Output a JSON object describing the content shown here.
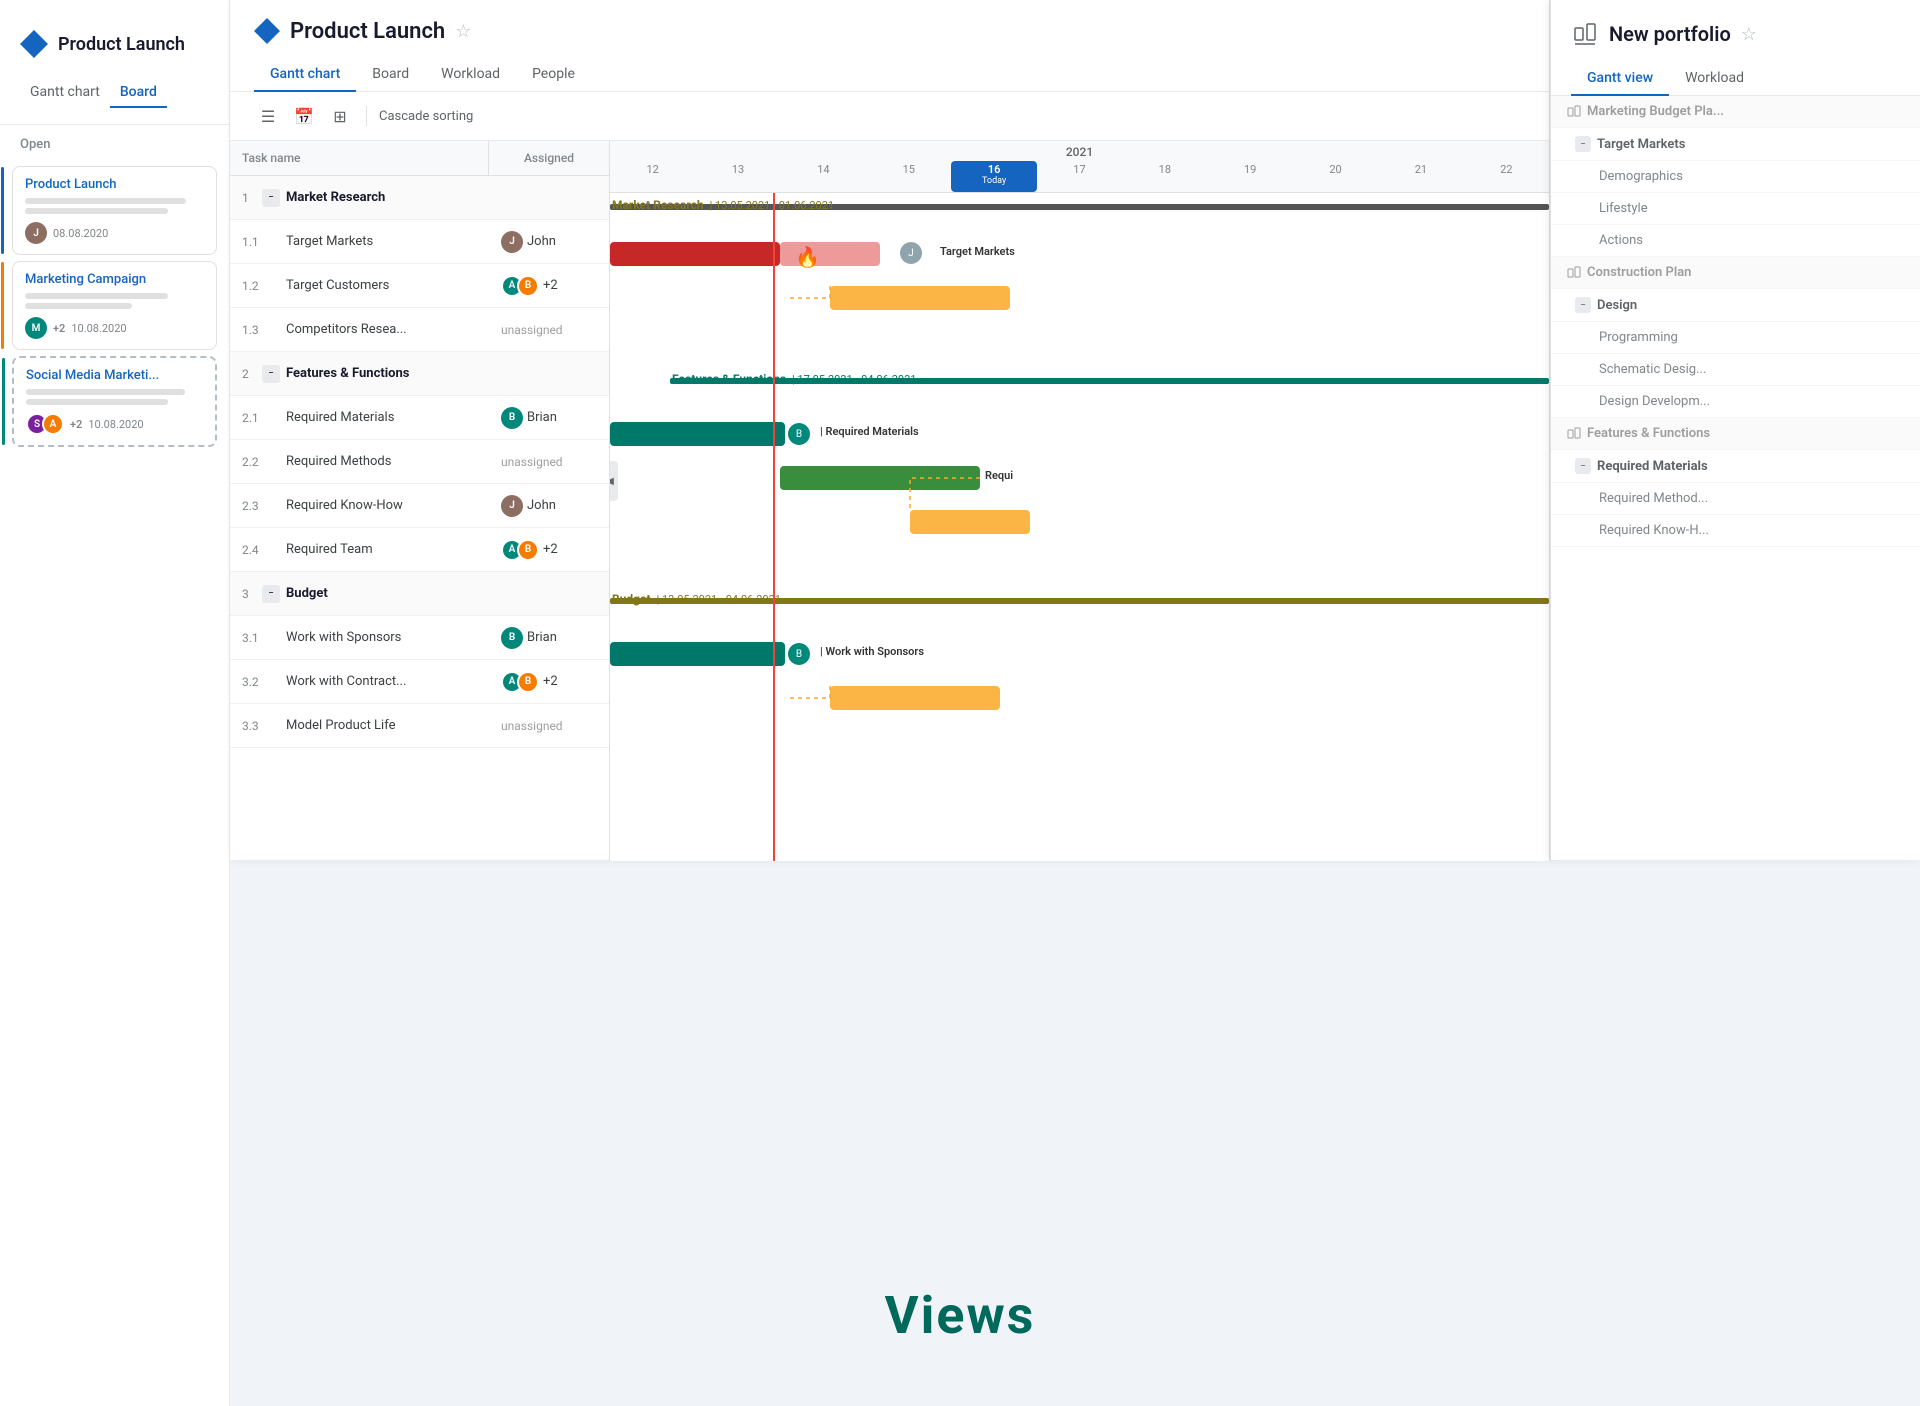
{
  "sidebar": {
    "title": "Product Launch",
    "nav": [
      {
        "label": "Gantt chart",
        "active": false
      },
      {
        "label": "Board",
        "active": true
      }
    ],
    "section": "Open",
    "cards": [
      {
        "id": "card-1",
        "title": "Product Launch",
        "bar_lengths": [
          "long",
          "medium"
        ],
        "avatar_color": "brown",
        "date": "08.08.2020",
        "accent": "blue"
      },
      {
        "id": "card-2",
        "title": "Marketing Campaign",
        "bar_lengths": [
          "medium",
          "short"
        ],
        "avatar_color": "teal",
        "plus": "+2",
        "date": "10.08.2020",
        "accent": "orange"
      },
      {
        "id": "card-3",
        "title": "Social Media Marketi...",
        "bar_lengths": [
          "long",
          "medium"
        ],
        "avatar_color": "purple",
        "plus": "+2",
        "date": "10.08.2020",
        "accent": "teal",
        "dashed": true
      }
    ]
  },
  "main": {
    "title": "Product Launch",
    "tabs": [
      {
        "label": "Gantt chart",
        "active": true
      },
      {
        "label": "Board",
        "active": false
      },
      {
        "label": "Workload",
        "active": false
      },
      {
        "label": "People",
        "active": false
      }
    ],
    "toolbar": {
      "cascade_sorting": "Cascade sorting"
    },
    "gantt": {
      "year": "2021",
      "today_label": "Today",
      "days": [
        "12",
        "13",
        "14",
        "15",
        "16",
        "17",
        "18",
        "19",
        "20",
        "21",
        "22"
      ],
      "today_index": 4,
      "columns": {
        "task_name": "Task name",
        "assigned": "Assigned"
      },
      "groups": [
        {
          "num": "1",
          "name": "Market Research",
          "label": "Market Research",
          "date_range": "13.05.2021 - 01.06.2021",
          "color": "olive",
          "children": [
            {
              "num": "1.1",
              "name": "Target Markets",
              "assigned": "John",
              "bar_color": "red",
              "bar_light": "red-light",
              "has_fire": true,
              "label": "Target Markets"
            },
            {
              "num": "1.2",
              "name": "Target Customers",
              "assigned": "multi",
              "plus": "+2",
              "bar_color": "gold"
            },
            {
              "num": "1.3",
              "name": "Competitors Resea...",
              "assigned": "unassigned"
            }
          ]
        },
        {
          "num": "2",
          "name": "Features & Functions",
          "label": "Features & Functions",
          "date_range": "17.05.2021 - 04.06.2021",
          "color": "teal",
          "children": [
            {
              "num": "2.1",
              "name": "Required Materials",
              "assigned": "Brian",
              "bar_color": "teal",
              "label": "Required Materials"
            },
            {
              "num": "2.2",
              "name": "Required Methods",
              "assigned": "unassigned",
              "bar_color": "green",
              "label": "Requi"
            },
            {
              "num": "2.3",
              "name": "Required Know-How",
              "assigned": "John",
              "bar_color": "gold"
            },
            {
              "num": "2.4",
              "name": "Required Team",
              "assigned": "multi",
              "plus": "+2"
            }
          ]
        },
        {
          "num": "3",
          "name": "Budget",
          "label": "Budget",
          "date_range": "13.05.2021 - 04.06.2021",
          "color": "olive",
          "children": [
            {
              "num": "3.1",
              "name": "Work with Sponsors",
              "assigned": "Brian",
              "bar_color": "teal",
              "label": "Work with Sponsors"
            },
            {
              "num": "3.2",
              "name": "Work with Contract...",
              "assigned": "multi",
              "plus": "+2",
              "bar_color": "gold"
            },
            {
              "num": "3.3",
              "name": "Model Product Life",
              "assigned": "unassigned"
            }
          ]
        }
      ]
    }
  },
  "right_panel": {
    "title": "New portfolio",
    "tabs": [
      {
        "label": "Gantt view",
        "active": true
      },
      {
        "label": "Workload",
        "active": false
      }
    ],
    "tree": [
      {
        "level": "group",
        "label": "Marketing Budget Pla...",
        "dimmed": true,
        "has_icon": true
      },
      {
        "level": "sub",
        "label": "Target Markets",
        "collapse": true
      },
      {
        "level": "sub2",
        "label": "Demographics"
      },
      {
        "level": "sub2",
        "label": "Lifestyle"
      },
      {
        "level": "sub2",
        "label": "Actions"
      },
      {
        "level": "group",
        "label": "Construction Plan",
        "dimmed": true,
        "has_icon": true
      },
      {
        "level": "sub",
        "label": "Design",
        "collapse": true
      },
      {
        "level": "sub2",
        "label": "Programming"
      },
      {
        "level": "sub2",
        "label": "Schematic Desig..."
      },
      {
        "level": "sub2",
        "label": "Design Developm..."
      },
      {
        "level": "group",
        "label": "Features & Functions",
        "dimmed": true,
        "has_icon": true
      },
      {
        "level": "sub",
        "label": "Required Materials",
        "collapse": true,
        "bold": true
      },
      {
        "level": "sub2",
        "label": "Required Method..."
      },
      {
        "level": "sub2",
        "label": "Required Know-H..."
      }
    ]
  },
  "bottom": {
    "views_label": "Views"
  }
}
